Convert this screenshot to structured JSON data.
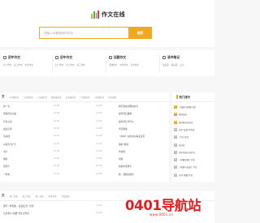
{
  "site": {
    "logo_text": "作文在线",
    "search_placeholder": "请输入你要搜索的内容",
    "search_button": "搜索"
  },
  "categories": [
    {
      "title": "初中作文",
      "icon": "book-icon",
      "links": [
        "初一作文",
        "初二作文",
        "中考作文"
      ]
    },
    {
      "title": "初中作文",
      "icon": "pen-icon",
      "links": [
        "初一作文",
        "初二作文",
        "初三作文"
      ]
    },
    {
      "title": "话题作文",
      "icon": "tag-icon",
      "links": [
        "话题作文",
        "中考作文",
        "高考作文"
      ]
    },
    {
      "title": "读书笔记",
      "icon": "note-icon",
      "links": [
        "读后感",
        "观后感",
        "日记"
      ]
    }
  ],
  "main_list": {
    "head": "文",
    "tabs": [
      "一年级作文",
      "二年级作文",
      "三年级作文",
      "四年级作文",
      "五年级作文",
      "六年级作文",
      "小升初作文",
      "作文周刊"
    ],
    "left_rows": [
      {
        "title": "的一次",
        "date": "12-06"
      },
      {
        "title": "寒假作文之美",
        "date": "12-06"
      },
      {
        "title": "行为心得",
        "date": "12-06"
      },
      {
        "title": "总结心得",
        "date": "12-06"
      },
      {
        "title": "马在线",
        "date": "12-06"
      },
      {
        "title": "以我为\"家\"字",
        "date": "12-06"
      },
      {
        "title": "书节",
        "date": "12-06"
      },
      {
        "title": "保护",
        "date": "12-06"
      },
      {
        "title": "的风声",
        "date": "12-06"
      },
      {
        "title": "一件事",
        "date": "12-06"
      }
    ],
    "right_rows": [
      {
        "title": "我们现在的那段时光",
        "date": "12-06"
      },
      {
        "title": "童年回忆趣事",
        "date": "12-06"
      },
      {
        "title": "童年回忆学什么",
        "date": "12-06"
      },
      {
        "title": "雪花飘落",
        "date": "12-06"
      },
      {
        "title": "《书中》如何用好事业意见",
        "date": "12-06"
      },
      {
        "title": "保护\"地球",
        "date": "12-06"
      },
      {
        "title": "学雷锋",
        "date": "12-06"
      },
      {
        "title": "雷锋",
        "date": "12-06"
      },
      {
        "title": "弟弟的毛笔字",
        "date": "12-06"
      },
      {
        "title": "我，我我的成长",
        "date": "12-06"
      }
    ]
  },
  "hot_ranking": {
    "title": "热门排行",
    "items": [
      {
        "rank": "1",
        "title": "《谦虚与骄傲小说》"
      },
      {
        "rank": "2",
        "title": "我的母亲"
      },
      {
        "rank": "3",
        "title": "保存我自己文化"
      },
      {
        "rank": "4",
        "title": "关于\"友谊\"的作文"
      },
      {
        "rank": "5",
        "title": "工作与生命"
      },
      {
        "rank": "6",
        "title": "高兴日"
      },
      {
        "rank": "7",
        "title": "关于传统节日作文"
      },
      {
        "rank": "8",
        "title": "《觉醒美雄》作文"
      },
      {
        "rank": "9",
        "title": "《她暖与成长》作文"
      },
      {
        "rank": "10",
        "title": "关于\"勇敢\"作文"
      }
    ]
  },
  "bottom_list": {
    "head": "文",
    "tabs": [
      "初一作文",
      "初二作文",
      "初三作文",
      "中考作文",
      "作文周刊"
    ],
    "rows": [
      {
        "title": "我们一样朋友，改变生活一份作",
        "date": "12-06"
      },
      {
        "title": "让梦想以\"展翼\"作文之作文",
        "date": "12-06"
      }
    ]
  },
  "watermark": {
    "text": "0401导航站",
    "sub": "www.0401.cn"
  },
  "colors": {
    "accent": "#f0a820",
    "watermark": "#e02020",
    "rank_top": "#f0a820",
    "rank_other": "#bbbbbb"
  }
}
